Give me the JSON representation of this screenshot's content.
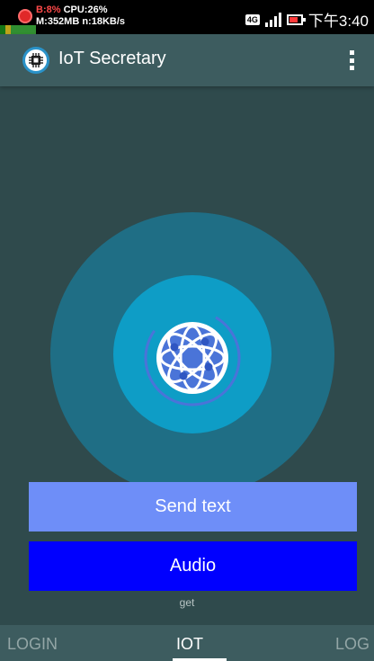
{
  "status_bar": {
    "cpu_warning": "B:8%",
    "cpu_label": "CPU:26%",
    "memory": "M:352MB n:18KB/s",
    "network_badge": "4G",
    "time": "下午3:40"
  },
  "app_bar": {
    "title": "IoT Secretary",
    "logo_icon": "chip-icon",
    "menu_icon": "more-vert-icon"
  },
  "main": {
    "center_icon": "globe-icon",
    "send_text_label": "Send text",
    "audio_label": "Audio",
    "status_text": "get"
  },
  "tabs": [
    {
      "label": "LOGIN",
      "selected": false
    },
    {
      "label": "IOT",
      "selected": true
    },
    {
      "label": "LOG",
      "selected": false
    }
  ],
  "colors": {
    "background": "#2f4a4c",
    "app_bar": "#3d5c5f",
    "outer_circle": "#1f6e85",
    "inner_circle": "#0e9dc6",
    "send_text_button": "#6e8ef8",
    "audio_button": "#0000ff"
  }
}
